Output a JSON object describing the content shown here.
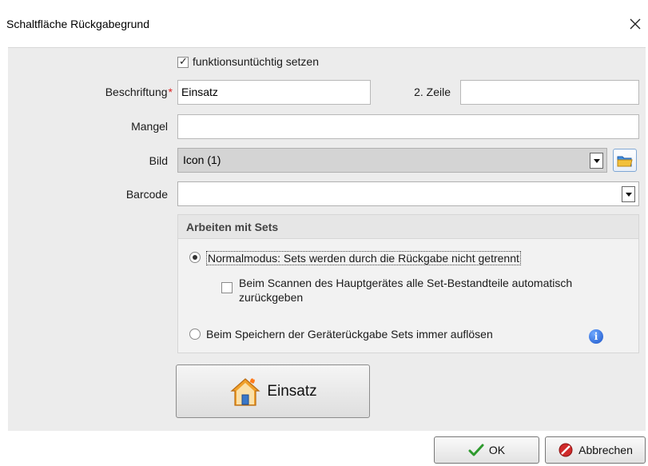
{
  "window": {
    "title": "Schaltfläche Rückgabegrund"
  },
  "form": {
    "defunct_checkbox": {
      "label": "funktionsuntüchtig setzen",
      "checked": true
    },
    "caption": {
      "label": "Beschriftung",
      "required_mark": "*",
      "value": "Einsatz"
    },
    "second_line": {
      "label": "2. Zeile",
      "value": ""
    },
    "defect": {
      "label": "Mangel",
      "value": ""
    },
    "image": {
      "label": "Bild",
      "value": "Icon (1)"
    },
    "barcode": {
      "label": "Barcode",
      "value": ""
    }
  },
  "sets": {
    "title": "Arbeiten mit Sets",
    "normal_mode": {
      "label": "Normalmodus: Sets werden durch die Rückgabe nicht getrennt",
      "selected": true
    },
    "auto_return": {
      "label_line1": "Beim Scannen des Hauptgerätes alle Set-Bestandteile automatisch",
      "label_line2": "zurückgeben",
      "checked": false
    },
    "always_dissolve": {
      "label": "Beim Speichern der Geräterückgabe Sets immer auflösen",
      "selected": false
    },
    "info_glyph": "i"
  },
  "preview_button": {
    "label": "Einsatz",
    "icon": "house-icon"
  },
  "footer": {
    "ok_label": "OK",
    "cancel_label": "Abbrechen"
  },
  "colors": {
    "required": "#d22222",
    "panel": "#ececec",
    "ok_check": "#2e9a2e",
    "cancel_red": "#d02a2a"
  }
}
